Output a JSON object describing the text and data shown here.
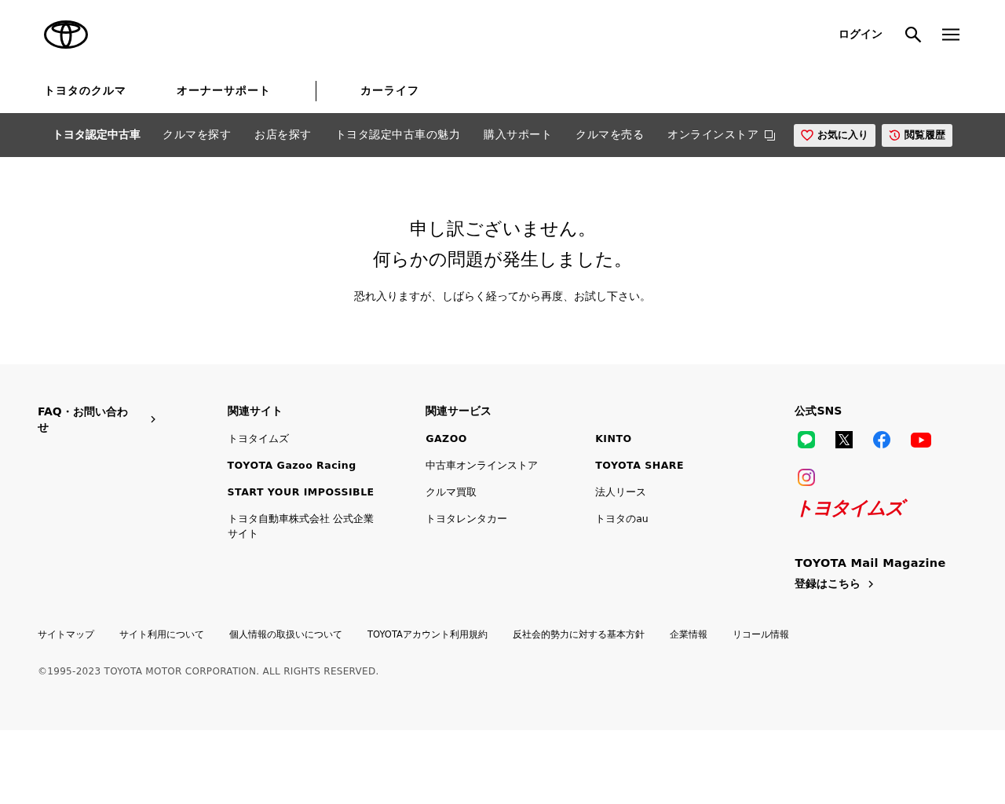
{
  "header": {
    "login": "ログイン"
  },
  "primary_nav": [
    {
      "label": "トヨタのクルマ",
      "divider_after": false
    },
    {
      "label": "オーナーサポート",
      "divider_after": true
    },
    {
      "label": "カーライフ",
      "divider_after": false
    }
  ],
  "sub_nav": {
    "title": "トヨタ認定中古車",
    "links": [
      {
        "label": "クルマを探す",
        "external": false
      },
      {
        "label": "お店を探す",
        "external": false
      },
      {
        "label": "トヨタ認定中古車の魅力",
        "external": false
      },
      {
        "label": "購入サポート",
        "external": false
      },
      {
        "label": "クルマを売る",
        "external": false
      },
      {
        "label": "オンラインストア",
        "external": true
      }
    ],
    "buttons": [
      {
        "label": "お気に入り",
        "kind": "favorite"
      },
      {
        "label": "閲覧履歴",
        "kind": "history"
      }
    ]
  },
  "error": {
    "title_lines": [
      "申し訳ございません。",
      "何らかの問題が発生しました。"
    ],
    "message": "恐れ入りますが、しばらく経ってから再度、お試し下さい。"
  },
  "footer": {
    "faq": {
      "label": "FAQ・お問い合わせ"
    },
    "related_sites": {
      "heading": "関連サイト",
      "links": [
        {
          "label": "トヨタイムズ",
          "bold": false
        },
        {
          "label": "TOYOTA Gazoo Racing",
          "bold": true
        },
        {
          "label": "START YOUR IMPOSSIBLE",
          "bold": true
        },
        {
          "label": "トヨタ自動車株式会社 公式企業サイト",
          "bold": false
        }
      ]
    },
    "related_services": {
      "heading": "関連サービス",
      "links": [
        {
          "label": "GAZOO",
          "bold": true
        },
        {
          "label": "KINTO",
          "bold": true
        },
        {
          "label": "中古車オンラインストア",
          "bold": false
        },
        {
          "label": "TOYOTA SHARE",
          "bold": true
        },
        {
          "label": "クルマ買取",
          "bold": false
        },
        {
          "label": "法人リース",
          "bold": false
        },
        {
          "label": "トヨタレンタカー",
          "bold": false
        },
        {
          "label": "トヨタのau",
          "bold": false
        }
      ]
    },
    "sns": {
      "heading": "公式SNS",
      "icons": [
        {
          "kind": "line"
        },
        {
          "kind": "x"
        },
        {
          "kind": "facebook"
        },
        {
          "kind": "youtube"
        },
        {
          "kind": "instagram"
        }
      ]
    },
    "brand_logo": "トヨタイムズ",
    "mail": {
      "heading": "TOYOTA Mail Magazine",
      "link": "登録はこちら"
    },
    "bottom_links": [
      "サイトマップ",
      "サイト利用について",
      "個人情報の取扱いについて",
      "TOYOTAアカウント利用規約",
      "反社会的勢力に対する基本方針",
      "企業情報",
      "リコール情報"
    ],
    "copyright": "©1995-2023 TOYOTA MOTOR CORPORATION. ALL RIGHTS RESERVED."
  }
}
